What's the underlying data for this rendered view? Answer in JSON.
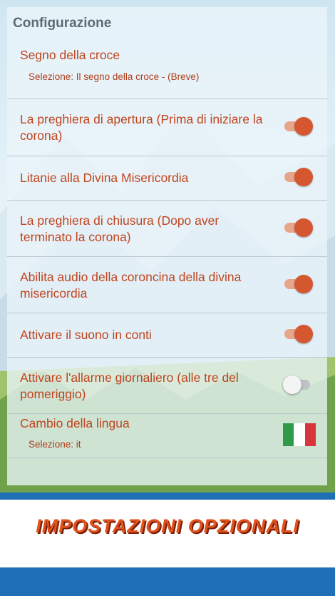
{
  "header": {
    "title": "Configurazione"
  },
  "sign_of_cross": {
    "label": "Segno della croce",
    "selection": "Selezione: Il segno della croce - (Breve)"
  },
  "toggles": [
    {
      "label": "La preghiera di apertura (Prima di iniziare la corona)",
      "on": true
    },
    {
      "label": "Litanie alla Divina Misericordia",
      "on": true
    },
    {
      "label": "La preghiera di chiusura (Dopo aver terminato la corona)",
      "on": true
    },
    {
      "label": "Abilita audio della coroncina della divina misericordia",
      "on": true
    },
    {
      "label": "Attivare il suono in conti",
      "on": true
    },
    {
      "label": "Attivare l'allarme giornaliero (alle tre del pomeriggio)",
      "on": false
    }
  ],
  "language": {
    "label": "Cambio della lingua",
    "selection": "Selezione: it",
    "flag_icon": "italy-flag-icon"
  },
  "banner": {
    "text": "IMPOSTAZIONI OPZIONALI"
  },
  "colors": {
    "accent": "#d4572f",
    "text": "#c0451f",
    "banner_blue": "#1e6fb6"
  }
}
